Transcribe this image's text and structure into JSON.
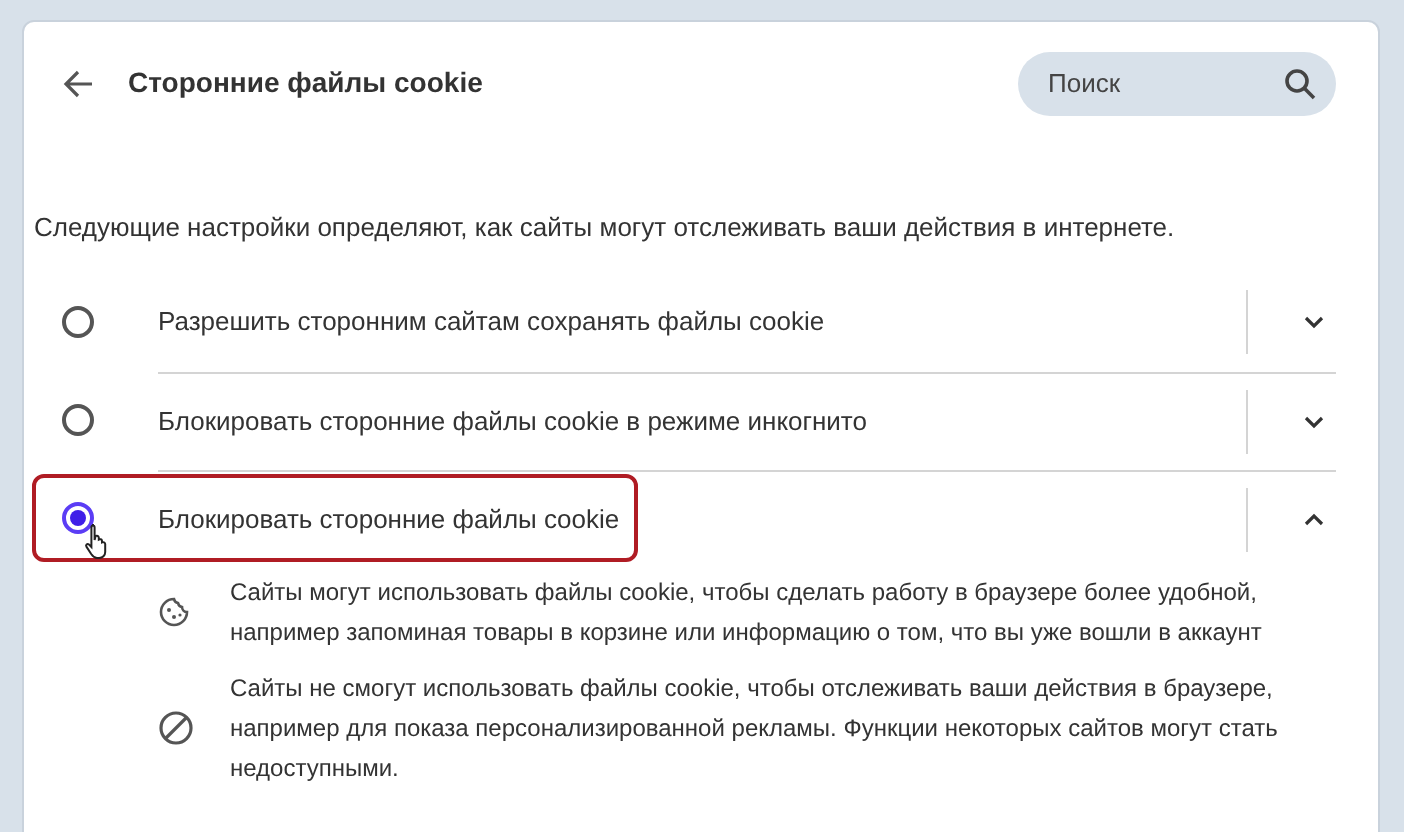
{
  "header": {
    "title": "Сторонние файлы cookie",
    "search": {
      "placeholder": "Поиск"
    }
  },
  "description": "Следующие настройки определяют, как сайты могут отслеживать ваши действия в интернете.",
  "options": [
    {
      "label": "Разрешить сторонним сайтам сохранять файлы cookie",
      "selected": false,
      "expanded": false,
      "highlighted": false
    },
    {
      "label": "Блокировать сторонние файлы cookie в режиме инкогнито",
      "selected": false,
      "expanded": false,
      "highlighted": false
    },
    {
      "label": "Блокировать сторонние файлы cookie",
      "selected": true,
      "expanded": true,
      "highlighted": true,
      "details": [
        {
          "kind": "cookie",
          "text": "Сайты могут использовать файлы cookie, чтобы сделать работу в браузере более удобной, например запоминая товары в корзине или информацию о том, что вы уже вошли в аккаунт"
        },
        {
          "kind": "block",
          "text": "Сайты не смогут использовать файлы cookie, чтобы отслеживать ваши действия в браузере, например для показа персонализированной рекламы. Функции некоторых сайтов могут стать недоступными."
        }
      ]
    }
  ]
}
